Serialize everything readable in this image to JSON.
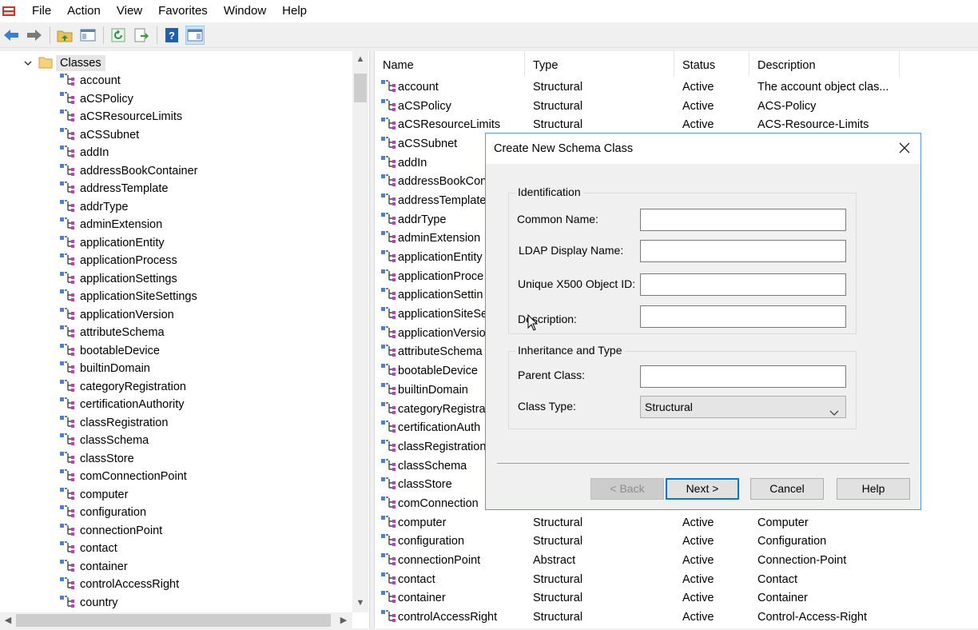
{
  "menu": [
    "File",
    "Action",
    "View",
    "Favorites",
    "Window",
    "Help"
  ],
  "toolbar": {
    "icons": [
      "back-arrow-icon",
      "forward-arrow-icon",
      "up-folder-icon",
      "show-hide-tree-icon",
      "refresh-icon",
      "export-list-icon",
      "help-icon",
      "show-hide-action-pane-icon"
    ]
  },
  "tree": {
    "root_label": "Classes",
    "items": [
      "account",
      "aCSPolicy",
      "aCSResourceLimits",
      "aCSSubnet",
      "addIn",
      "addressBookContainer",
      "addressTemplate",
      "addrType",
      "adminExtension",
      "applicationEntity",
      "applicationProcess",
      "applicationSettings",
      "applicationSiteSettings",
      "applicationVersion",
      "attributeSchema",
      "bootableDevice",
      "builtinDomain",
      "categoryRegistration",
      "certificationAuthority",
      "classRegistration",
      "classSchema",
      "classStore",
      "comConnectionPoint",
      "computer",
      "configuration",
      "connectionPoint",
      "contact",
      "container",
      "controlAccessRight",
      "country"
    ]
  },
  "list": {
    "columns": [
      "Name",
      "Type",
      "Status",
      "Description"
    ],
    "rows": [
      {
        "name": "account",
        "type": "Structural",
        "status": "Active",
        "description": "The account object clas..."
      },
      {
        "name": "aCSPolicy",
        "type": "Structural",
        "status": "Active",
        "description": "ACS-Policy"
      },
      {
        "name": "aCSResourceLimits",
        "type": "Structural",
        "status": "Active",
        "description": "ACS-Resource-Limits"
      },
      {
        "name": "aCSSubnet",
        "type": "",
        "status": "",
        "description": ""
      },
      {
        "name": "addIn",
        "type": "",
        "status": "",
        "description": ""
      },
      {
        "name": "addressBookCon",
        "type": "",
        "status": "",
        "description": ""
      },
      {
        "name": "addressTemplate",
        "type": "",
        "status": "",
        "description": ""
      },
      {
        "name": "addrType",
        "type": "",
        "status": "",
        "description": ""
      },
      {
        "name": "adminExtension",
        "type": "",
        "status": "",
        "description": ""
      },
      {
        "name": "applicationEntity",
        "type": "",
        "status": "",
        "description": ""
      },
      {
        "name": "applicationProce",
        "type": "",
        "status": "",
        "description": ""
      },
      {
        "name": "applicationSettin",
        "type": "",
        "status": "",
        "description": ""
      },
      {
        "name": "applicationSiteSe",
        "type": "",
        "status": "",
        "description": ""
      },
      {
        "name": "applicationVersio",
        "type": "",
        "status": "",
        "description": ""
      },
      {
        "name": "attributeSchema",
        "type": "",
        "status": "",
        "description": ""
      },
      {
        "name": "bootableDevice",
        "type": "",
        "status": "",
        "description": ""
      },
      {
        "name": "builtinDomain",
        "type": "",
        "status": "",
        "description": ""
      },
      {
        "name": "categoryRegistra",
        "type": "",
        "status": "",
        "description": ""
      },
      {
        "name": "certificationAuth",
        "type": "",
        "status": "",
        "description": ""
      },
      {
        "name": "classRegistration",
        "type": "",
        "status": "",
        "description": ""
      },
      {
        "name": "classSchema",
        "type": "",
        "status": "",
        "description": ""
      },
      {
        "name": "classStore",
        "type": "",
        "status": "",
        "description": ""
      },
      {
        "name": "comConnection",
        "type": "",
        "status": "",
        "description": ""
      },
      {
        "name": "computer",
        "type": "Structural",
        "status": "Active",
        "description": "Computer"
      },
      {
        "name": "configuration",
        "type": "Structural",
        "status": "Active",
        "description": "Configuration"
      },
      {
        "name": "connectionPoint",
        "type": "Abstract",
        "status": "Active",
        "description": "Connection-Point"
      },
      {
        "name": "contact",
        "type": "Structural",
        "status": "Active",
        "description": "Contact"
      },
      {
        "name": "container",
        "type": "Structural",
        "status": "Active",
        "description": "Container"
      },
      {
        "name": "controlAccessRight",
        "type": "Structural",
        "status": "Active",
        "description": "Control-Access-Right"
      }
    ]
  },
  "dialog": {
    "title": "Create New Schema Class",
    "identification_legend": "Identification",
    "common_name_label": "Common Name:",
    "common_name_value": "",
    "ldap_display_name_label": "LDAP Display Name:",
    "ldap_display_name_value": "",
    "x500_oid_label": "Unique X500 Object ID:",
    "x500_oid_value": "",
    "description_label": "Description:",
    "description_value": "",
    "inheritance_legend": "Inheritance and Type",
    "parent_class_label": "Parent Class:",
    "parent_class_value": "",
    "class_type_label": "Class Type:",
    "class_type_value": "Structural",
    "back_label": "< Back",
    "next_label": "Next >",
    "cancel_label": "Cancel",
    "help_label": "Help"
  },
  "colors": {
    "dialog_border": "#5b9bd5",
    "default_button_border": "#0078d7",
    "tree_selection": "#e5e5e5"
  }
}
